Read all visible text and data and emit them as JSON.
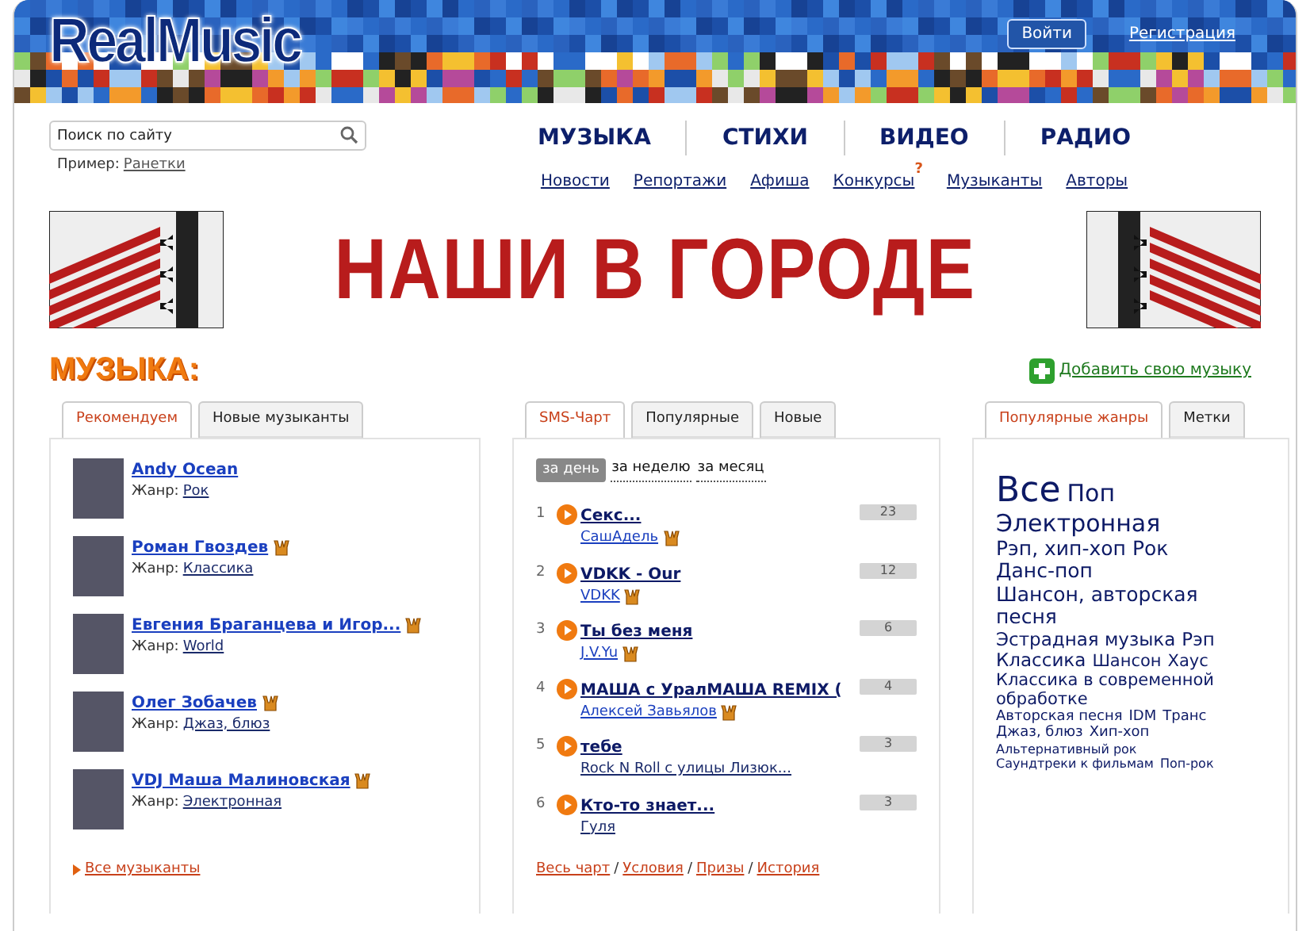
{
  "header": {
    "logo": "RealMusic",
    "login": "Войти",
    "register": "Регистрация"
  },
  "search": {
    "placeholder": "Поиск по сайту",
    "example_label": "Пример:",
    "example_link": "Ранетки"
  },
  "main_nav": [
    {
      "label": "МУЗЫКА"
    },
    {
      "label": "СТИХИ"
    },
    {
      "label": "ВИДЕО"
    },
    {
      "label": "РАДИО"
    }
  ],
  "sub_nav": [
    {
      "label": "Новости"
    },
    {
      "label": "Репортажи"
    },
    {
      "label": "Афиша"
    },
    {
      "label": "Конкурсы",
      "badge": "?"
    },
    {
      "label": "Музыканты"
    },
    {
      "label": "Авторы"
    }
  ],
  "banner": {
    "text": "НАШИ В ГОРОДЕ"
  },
  "section": {
    "title": "МУЗЫКА:",
    "add_link": "Добавить свою музыку"
  },
  "musicians": {
    "tabs": [
      {
        "label": "Рекомендуем",
        "selected": true
      },
      {
        "label": "Новые музыканты",
        "selected": false
      }
    ],
    "items": [
      {
        "name": "Andy Ocean",
        "genre_label": "Жанр:",
        "genre": "Рок",
        "horns": false
      },
      {
        "name": "Роман Гвоздев",
        "genre_label": "Жанр:",
        "genre": "Классика",
        "horns": true
      },
      {
        "name": "Евгения Браганцева и Игор...",
        "genre_label": "Жанр:",
        "genre": "World",
        "horns": true
      },
      {
        "name": "Олег Зобачев",
        "genre_label": "Жанр:",
        "genre": "Джаз, блюз",
        "horns": true
      },
      {
        "name": "VDJ Маша Малиновская",
        "genre_label": "Жанр:",
        "genre": "Электронная",
        "horns": true
      }
    ],
    "footer_link": "Все музыканты"
  },
  "chart": {
    "tabs": [
      {
        "label": "SMS-Чарт",
        "selected": true
      },
      {
        "label": "Популярные",
        "selected": false
      },
      {
        "label": "Новые",
        "selected": false
      }
    ],
    "periods": [
      {
        "label": "за день",
        "selected": true
      },
      {
        "label": "за неделю",
        "selected": false
      },
      {
        "label": "за месяц",
        "selected": false
      }
    ],
    "rows": [
      {
        "rank": "1",
        "title": "Секс...",
        "artist": "СашАдель",
        "horns": true,
        "count": "23"
      },
      {
        "rank": "2",
        "title": "VDKK - Our",
        "artist": "VDKK",
        "horns": true,
        "count": "12"
      },
      {
        "rank": "3",
        "title": "Ты без меня",
        "artist": "J.V.Yu",
        "horns": true,
        "count": "6"
      },
      {
        "rank": "4",
        "title": "МАША с УралМАША REMIX (",
        "artist": "Алексей Завьялов",
        "horns": true,
        "count": "4"
      },
      {
        "rank": "5",
        "title": "тебе",
        "artist": "Rock N Roll с улицы Лизюк...",
        "horns": false,
        "count": "3"
      },
      {
        "rank": "6",
        "title": "Кто-то знает...",
        "artist": "Гуля",
        "horns": false,
        "count": "3"
      }
    ],
    "footer_links": [
      "Весь чарт",
      "Условия",
      "Призы",
      "История"
    ],
    "separator": "/"
  },
  "genres": {
    "tabs": [
      {
        "label": "Популярные жанры",
        "selected": true
      },
      {
        "label": "Метки",
        "selected": false
      }
    ],
    "tags": [
      {
        "label": "Все",
        "kind": "xl"
      },
      {
        "label": "Поп",
        "kind": "lg"
      },
      {
        "label": "Электронная",
        "kind": "lg"
      },
      {
        "label": "Рэп, хип-хоп",
        "kind": "md"
      },
      {
        "label": "Рок",
        "kind": "md"
      },
      {
        "label": "Данс-поп",
        "kind": "md"
      },
      {
        "label": "Шансон, авторская песня",
        "kind": "md"
      },
      {
        "label": "Эстрадная музыка",
        "kind": "sm"
      },
      {
        "label": "Рэп",
        "kind": "sm"
      },
      {
        "label": "Классика",
        "kind": "sm"
      },
      {
        "label": "Шансон",
        "kind": "xs"
      },
      {
        "label": "Хаус",
        "kind": "xs"
      },
      {
        "label": "Классика в современной обработке",
        "kind": "xs"
      },
      {
        "label": "Авторская песня",
        "kind": "xxs"
      },
      {
        "label": "IDM",
        "kind": "xxs"
      },
      {
        "label": "Транс",
        "kind": "xxs"
      },
      {
        "label": "Джаз, блюз",
        "kind": "xxs"
      },
      {
        "label": "Хип-хоп",
        "kind": "xxs"
      },
      {
        "label": "Альтернативный рок",
        "kind": "tiny"
      },
      {
        "label": "Саундтреки к фильмам",
        "kind": "tiny"
      },
      {
        "label": "Поп-рок",
        "kind": "tiny"
      }
    ]
  }
}
